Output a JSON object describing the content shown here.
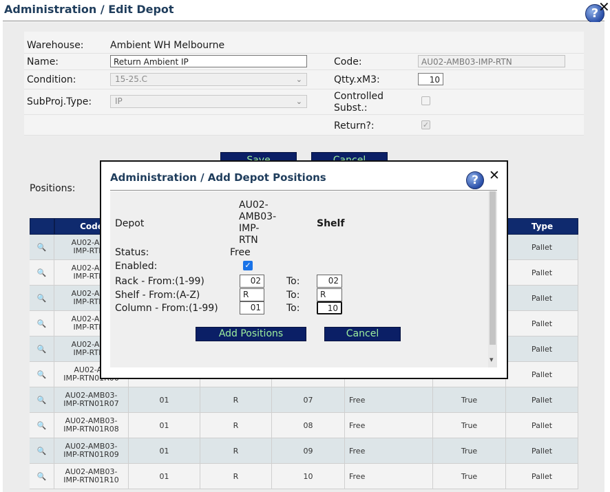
{
  "page": {
    "title": "Administration / Edit Depot",
    "help_glyph": "?",
    "close_glyph": "✕"
  },
  "form": {
    "warehouse_label": "Warehouse:",
    "warehouse_value": "Ambient WH Melbourne",
    "name_label": "Name:",
    "name_value": "Return Ambient IP",
    "code_label": "Code:",
    "code_value": "AU02-AMB03-IMP-RTN",
    "condition_label": "Condition:",
    "condition_value": "15-25.C",
    "qtty_label": "Qtty.xM3:",
    "qtty_value": "10",
    "subproj_label": "SubProj.Type:",
    "subproj_value": "IP",
    "controlled_label_1": "Controlled",
    "controlled_label_2": "Subst.:",
    "return_label": "Return?:",
    "save_label": "Save",
    "cancel_label": "Cancel"
  },
  "positions_label": "Positions:",
  "grid": {
    "headers": [
      "",
      "Code",
      "",
      "",
      "",
      "",
      "",
      "Type"
    ],
    "rows": [
      {
        "code1": "AU02-AMB",
        "code2": "IMP-RTN0",
        "rack": "",
        "shelf": "",
        "col": "",
        "status": "",
        "enabled": "",
        "type": "Pallet"
      },
      {
        "code1": "AU02-AMB",
        "code2": "IMP-RTN0",
        "rack": "",
        "shelf": "",
        "col": "",
        "status": "",
        "enabled": "",
        "type": "Pallet"
      },
      {
        "code1": "AU02-AMB",
        "code2": "IMP-RTN0",
        "rack": "",
        "shelf": "",
        "col": "",
        "status": "",
        "enabled": "",
        "type": "Pallet"
      },
      {
        "code1": "AU02-AMB",
        "code2": "IMP-RTN0",
        "rack": "",
        "shelf": "",
        "col": "",
        "status": "",
        "enabled": "",
        "type": "Pallet"
      },
      {
        "code1": "AU02-AMB",
        "code2": "IMP-RTN0",
        "rack": "",
        "shelf": "",
        "col": "",
        "status": "",
        "enabled": "",
        "type": "Pallet"
      },
      {
        "code1": "AU02-AM",
        "code2": "IMP-RTN01R06",
        "rack": "",
        "shelf": "",
        "col": "",
        "status": "",
        "enabled": "",
        "type": "Pallet"
      },
      {
        "code1": "AU02-AMB03-",
        "code2": "IMP-RTN01R07",
        "rack": "01",
        "shelf": "R",
        "col": "07",
        "status": "Free",
        "enabled": "True",
        "type": "Pallet"
      },
      {
        "code1": "AU02-AMB03-",
        "code2": "IMP-RTN01R08",
        "rack": "01",
        "shelf": "R",
        "col": "08",
        "status": "Free",
        "enabled": "True",
        "type": "Pallet"
      },
      {
        "code1": "AU02-AMB03-",
        "code2": "IMP-RTN01R09",
        "rack": "01",
        "shelf": "R",
        "col": "09",
        "status": "Free",
        "enabled": "True",
        "type": "Pallet"
      },
      {
        "code1": "AU02-AMB03-",
        "code2": "IMP-RTN01R10",
        "rack": "01",
        "shelf": "R",
        "col": "10",
        "status": "Free",
        "enabled": "True",
        "type": "Pallet"
      }
    ]
  },
  "modal": {
    "title": "Administration / Add Depot Positions",
    "help_glyph": "?",
    "close_glyph": "✕",
    "depot_label": "Depot",
    "depot_value_lines": [
      "AU02-",
      "AMB03-",
      "IMP-",
      "RTN"
    ],
    "shelf_heading": "Shelf",
    "status_label": "Status:",
    "status_value": "Free",
    "enabled_label": "Enabled:",
    "enabled_glyph": "✓",
    "rack_label": "Rack - From:(1-99)",
    "rack_from": "02",
    "rack_to": "02",
    "shelf_label": "Shelf - From:(A-Z)",
    "shelf_from": "R",
    "shelf_to": "R",
    "column_label": "Column - From:(1-99)",
    "column_from": "01",
    "column_to": "10",
    "to_label": "To:",
    "add_label": "Add Positions",
    "cancel_label": "Cancel",
    "scroll_down_glyph": "▾"
  }
}
